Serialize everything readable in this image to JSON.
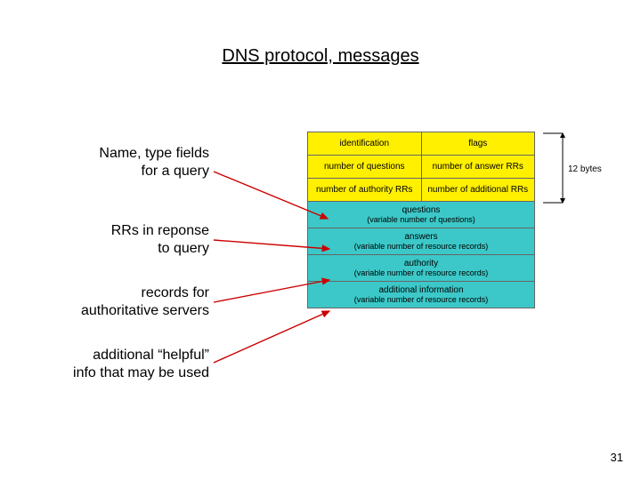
{
  "title": "DNS protocol, messages",
  "labels": {
    "l1a": "Name, type fields",
    "l1b": "for a query",
    "l2a": "RRs in reponse",
    "l2b": "to query",
    "l3a": "records for",
    "l3b": "authoritative servers",
    "l4a": "additional “helpful”",
    "l4b": "info that may be used"
  },
  "header": {
    "r1c1": "identification",
    "r1c2": "flags",
    "r2c1": "number of questions",
    "r2c2": "number of answer RRs",
    "r3c1": "number of authority RRs",
    "r3c2": "number of additional RRs"
  },
  "body": {
    "q1": "questions",
    "q2": "(variable number of questions)",
    "a1": "answers",
    "a2": "(variable number of resource records)",
    "u1": "authority",
    "u2": "(variable number of resource records)",
    "d1": "additional information",
    "d2": "(variable number of resource records)"
  },
  "sidecap": "12 bytes",
  "pagenum": "31"
}
